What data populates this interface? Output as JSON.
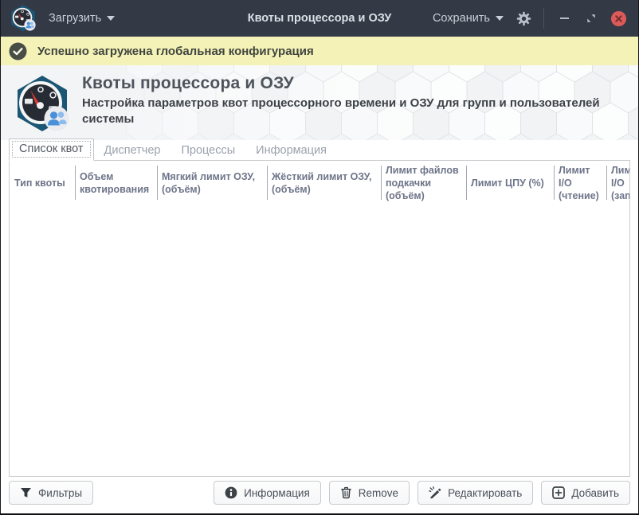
{
  "window": {
    "title": "Квоты процессора и ОЗУ",
    "load_button": "Загрузить",
    "save_button": "Сохранить"
  },
  "notification": {
    "message": "Успешно загружена глобальная конфигурация",
    "type": "success"
  },
  "header": {
    "title": "Квоты процессора и ОЗУ",
    "subtitle": "Настройка параметров квот процессорного времени и ОЗУ для групп и пользователей системы"
  },
  "tabs": [
    {
      "label": "Список квот",
      "active": true
    },
    {
      "label": "Диспетчер",
      "active": false
    },
    {
      "label": "Процессы",
      "active": false
    },
    {
      "label": "Информация",
      "active": false
    }
  ],
  "table": {
    "columns": [
      "Тип квоты",
      "Объем квотирования",
      "Мягкий лимит ОЗУ, (объём)",
      "Жёсткий лимит ОЗУ, (объём)",
      "Лимит файлов подкачки (объём)",
      "Лимит ЦПУ (%)",
      "Лимит I/O (чтение)",
      "Лимит I/O (запись)"
    ],
    "rows": []
  },
  "actions": {
    "filters": "Фильтры",
    "information": "Информация",
    "remove": "Remove",
    "edit": "Редактировать",
    "add": "Добавить"
  },
  "icons": {
    "app": "gauge-hexagon-users",
    "load_caret": "triangle-down",
    "save_caret": "triangle-down",
    "settings": "gear",
    "minimize": "minus",
    "restore": "restore-corners",
    "close": "red-circle-cross",
    "notification": "check-circle",
    "filters": "funnel",
    "information": "info-circle",
    "remove": "trash",
    "edit": "pencil-sparkle",
    "add": "plus-square"
  },
  "colors": {
    "titlebar": "#343a45",
    "notification_bg": "#f5f2b7",
    "close_button": "#dc5a5a",
    "accent_blue": "#4a90d9",
    "logo_hex": "#1b5674",
    "header_title": "#4e545c",
    "table_header_text": "#6e7589"
  }
}
